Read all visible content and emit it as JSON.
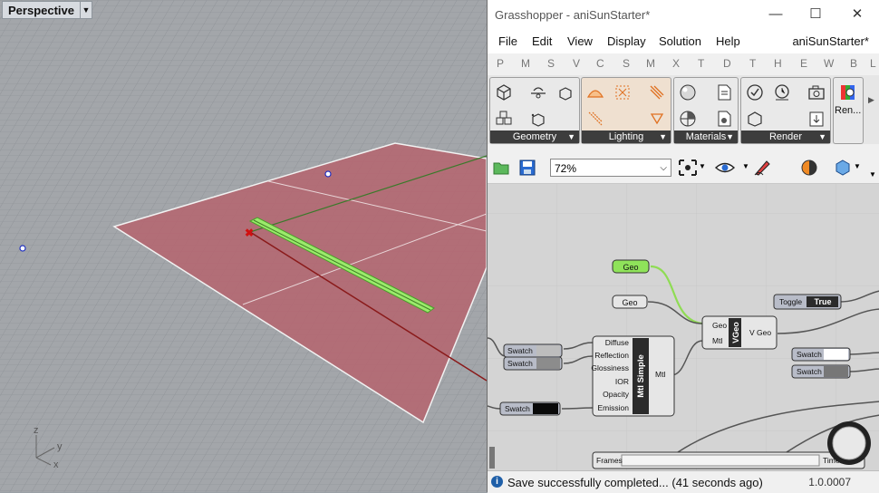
{
  "viewport": {
    "name": "Perspective",
    "axes": {
      "z": "z",
      "y": "y",
      "x": "x"
    }
  },
  "grasshopper": {
    "title": "Grasshopper - aniSunStarter*",
    "document_name": "aniSunStarter*",
    "menu": [
      "File",
      "Edit",
      "View",
      "Display",
      "Solution",
      "Help"
    ],
    "categories": [
      "P",
      "M",
      "S",
      "V",
      "C",
      "S",
      "M",
      "X",
      "T",
      "D",
      "T",
      "H",
      "E",
      "W",
      "B",
      "L"
    ],
    "panels": [
      {
        "label": "Geometry"
      },
      {
        "label": "Lighting"
      },
      {
        "label": "Materials"
      },
      {
        "label": "Render"
      },
      {
        "label": "Ren..."
      }
    ],
    "zoom": "72%",
    "status_message": "Save successfully completed... (41 seconds ago)",
    "version": "1.0.0007"
  },
  "components": {
    "geo1": "Geo",
    "geo2": "Geo",
    "toggle_label": "Toggle",
    "toggle_value": "True",
    "swatch": "Swatch",
    "mtl_simple": {
      "name": "Mtl Simple",
      "inputs": [
        "Diffuse",
        "Reflection",
        "Glossiness",
        "IOR",
        "Opacity",
        "Emission"
      ],
      "output": "Mtl"
    },
    "vgeo": {
      "name": "VGeo",
      "inputs": [
        "Geo",
        "Mtl"
      ],
      "output": "V Geo"
    },
    "frames": "Frames",
    "timer": "Timer"
  },
  "colors": {
    "ground": "#b5646f",
    "selected": "#7fe04d",
    "wire": "#555555"
  }
}
